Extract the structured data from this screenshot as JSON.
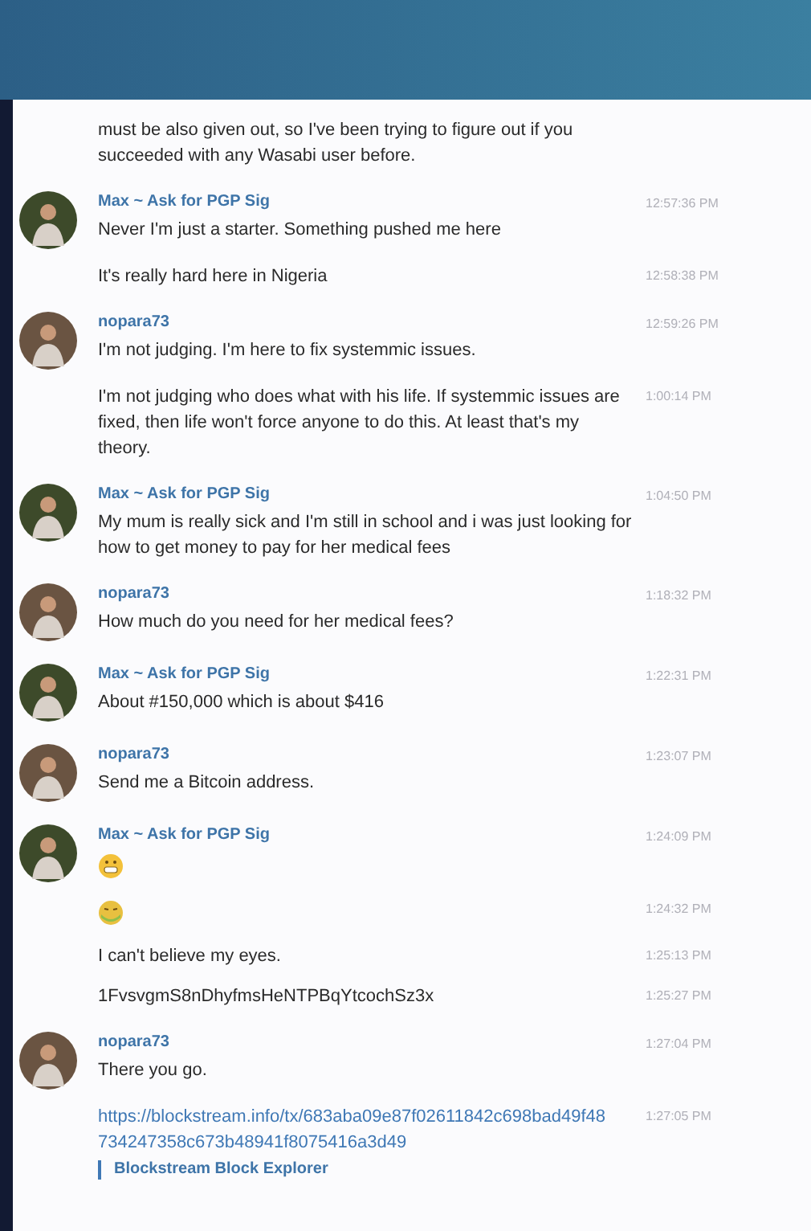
{
  "messages": [
    {
      "kind": "text",
      "text": "must be also given out, so I've been trying to figure out if you succeeded with any Wasabi user before."
    },
    {
      "kind": "text",
      "sender": "Max ~ Ask for PGP Sig",
      "color": "#3d4a2a",
      "text": "Never I'm just a starter. Something pushed me here",
      "time": "12:57:36 PM"
    },
    {
      "kind": "text",
      "text": "It's really hard here in Nigeria",
      "time": "12:58:38 PM"
    },
    {
      "kind": "text",
      "sender": "nopara73",
      "color": "#6a5442",
      "text": "I'm not judging. I'm here to fix systemmic issues.",
      "time": "12:59:26 PM"
    },
    {
      "kind": "text",
      "text": "I'm not judging who does what with his life. If systemmic issues are fixed, then life won't force anyone to do this. At least that's my theory.",
      "time": "1:00:14 PM"
    },
    {
      "kind": "text",
      "sender": "Max ~ Ask for PGP Sig",
      "color": "#3d4a2a",
      "text": "My mum is really sick and I'm still in school and i was just looking for how to get money to pay for her medical fees",
      "time": "1:04:50 PM"
    },
    {
      "kind": "text",
      "sender": "nopara73",
      "color": "#6a5442",
      "text": "How much do you need for her medical fees?",
      "time": "1:18:32 PM"
    },
    {
      "kind": "text",
      "sender": "Max ~ Ask for PGP Sig",
      "color": "#3d4a2a",
      "text": "About #150,000 which is about $416",
      "time": "1:22:31 PM"
    },
    {
      "kind": "text",
      "sender": "nopara73",
      "color": "#6a5442",
      "text": "Send me a Bitcoin address.",
      "time": "1:23:07 PM"
    },
    {
      "kind": "grimace",
      "sender": "Max ~ Ask for PGP Sig",
      "color": "#3d4a2a",
      "time": "1:24:09 PM"
    },
    {
      "kind": "sick",
      "time": "1:24:32 PM"
    },
    {
      "kind": "text",
      "text": "I can't believe my eyes.",
      "time": "1:25:13 PM"
    },
    {
      "kind": "text",
      "text": "1FvsvgmS8nDhyfmsHeNTPBqYtcochSz3x",
      "time": "1:25:27 PM"
    },
    {
      "kind": "text",
      "sender": "nopara73",
      "color": "#6a5442",
      "text": "There you go.",
      "time": "1:27:04 PM"
    },
    {
      "kind": "link",
      "text": "https://blockstream.info/tx/683aba09e87f02611842c698bad49f48 734247358c673b48941f8075416a3d49",
      "preview": "Blockstream Block Explorer",
      "time": "1:27:05 PM"
    }
  ]
}
